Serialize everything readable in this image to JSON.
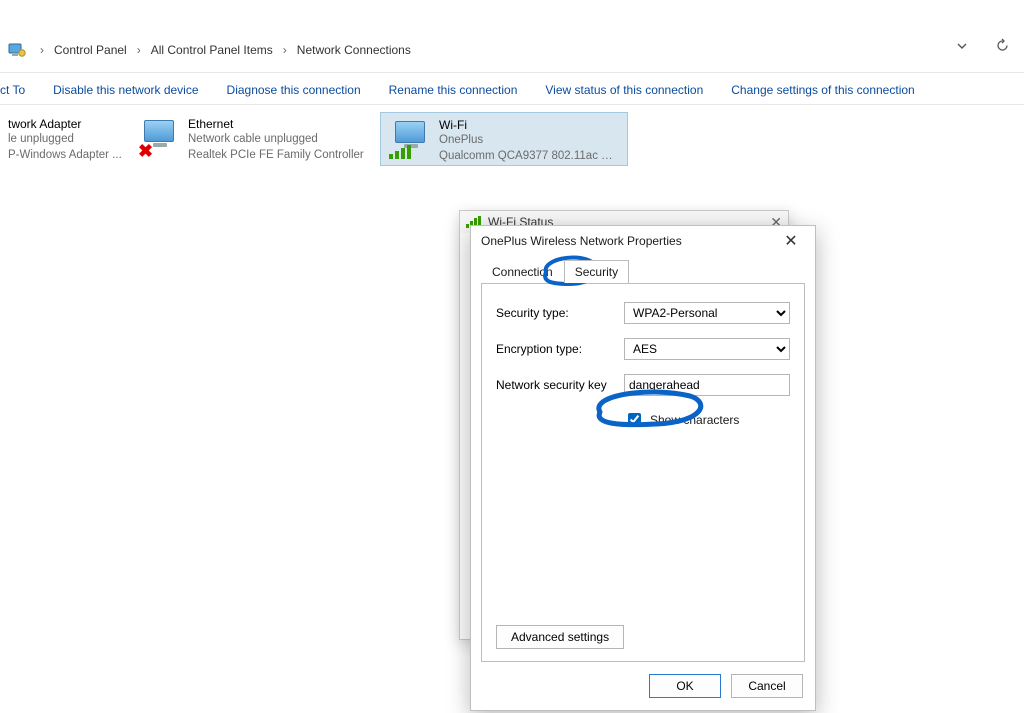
{
  "breadcrumb": {
    "a": "Control Panel",
    "b": "All Control Panel Items",
    "c": "Network Connections"
  },
  "cmd": {
    "connect_to": "ct To",
    "disable": "Disable this network device",
    "diagnose": "Diagnose this connection",
    "rename": "Rename this connection",
    "view_status": "View status of this connection",
    "change_settings": "Change settings of this connection"
  },
  "adapters": {
    "a0": {
      "t1": "twork Adapter",
      "t2": "le unplugged",
      "t3": "P-Windows Adapter ..."
    },
    "a1": {
      "t1": "Ethernet",
      "t2": "Network cable unplugged",
      "t3": "Realtek PCIe FE Family Controller"
    },
    "a2": {
      "t1": "Wi-Fi",
      "t2": "OnePlus",
      "t3": "Qualcomm QCA9377 802.11ac Wi..."
    }
  },
  "wifi_status_title": "Wi-Fi Status",
  "props": {
    "title": "OnePlus Wireless Network Properties",
    "tab_connection": "Connection",
    "tab_security": "Security",
    "sec_type_label": "Security type:",
    "sec_type_value": "WPA2-Personal",
    "enc_type_label": "Encryption type:",
    "enc_type_value": "AES",
    "key_label": "Network security key",
    "key_value": "dangerahead",
    "show_chars": "Show characters",
    "advanced": "Advanced settings",
    "ok": "OK",
    "cancel": "Cancel"
  }
}
